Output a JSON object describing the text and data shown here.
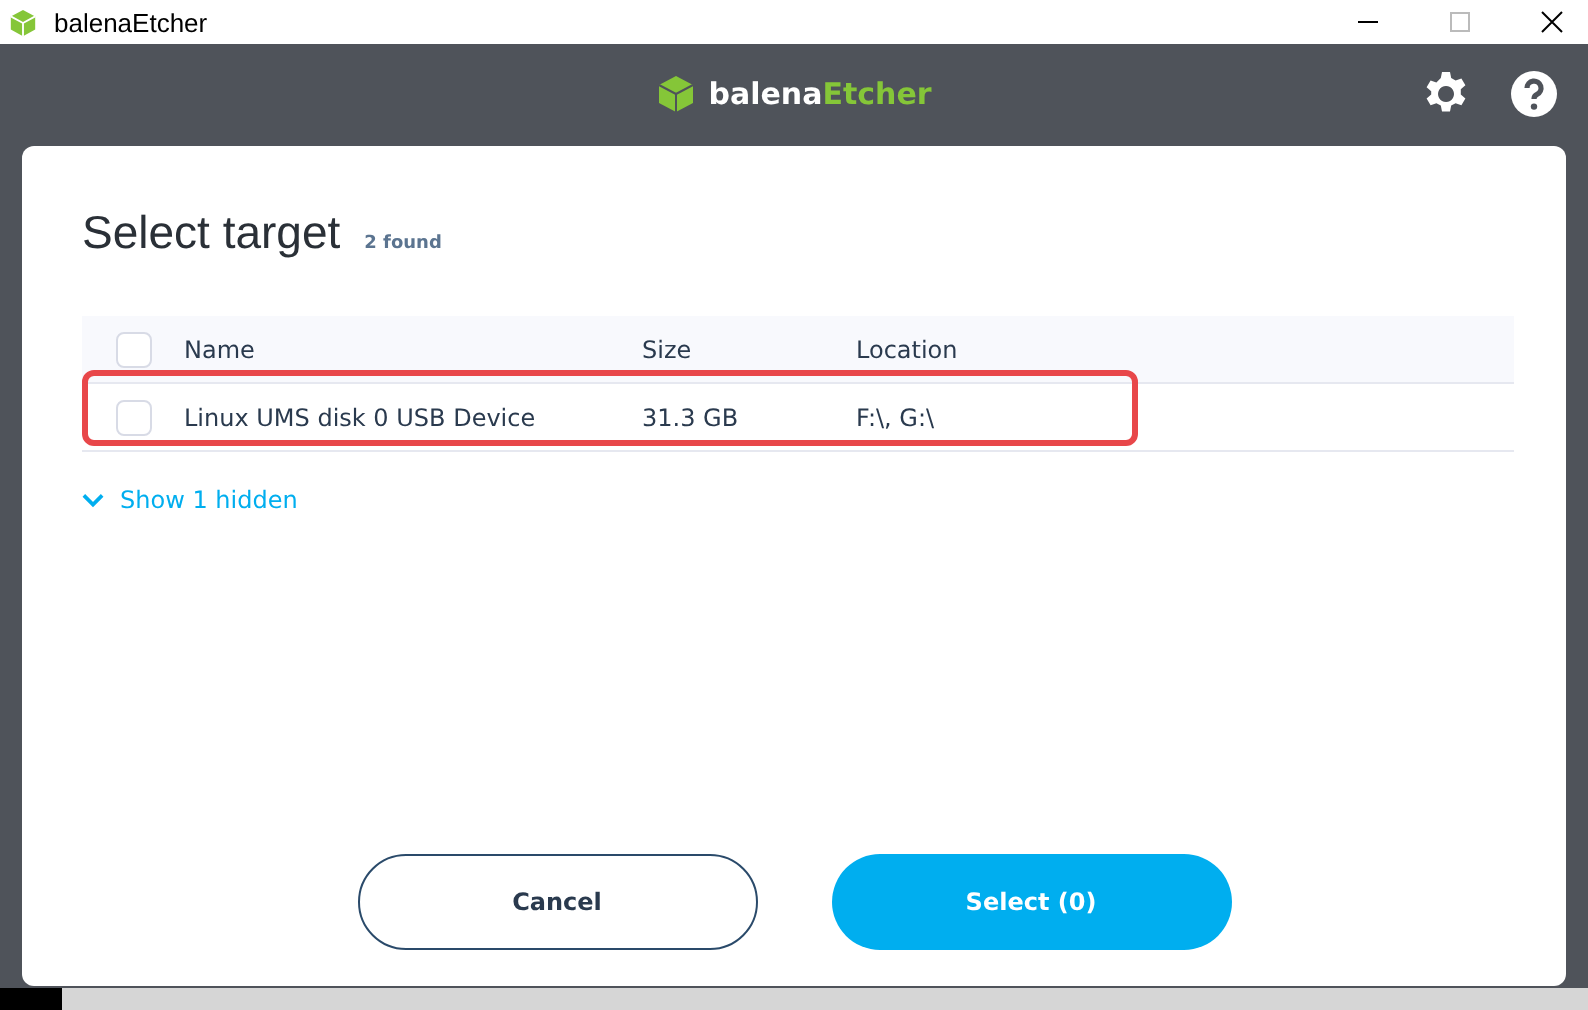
{
  "window": {
    "title": "balenaEtcher"
  },
  "header": {
    "logo_parts": [
      "balena",
      "Etcher"
    ]
  },
  "dialog": {
    "title": "Select target",
    "count": "2 found",
    "table": {
      "all_checked": false,
      "columns": [
        "Name",
        "Size",
        "Location"
      ],
      "rows": [
        {
          "cells": [
            "Linux UMS disk 0 USB Device",
            "31.3 GB",
            "F:\\, G:\\"
          ],
          "checked": false,
          "highlighted": true
        }
      ]
    },
    "show_hidden": "Show 1 hidden",
    "buttons": [
      {
        "label": "Cancel",
        "kind": "secondary"
      },
      {
        "label": "Select (0)",
        "kind": "primary"
      }
    ]
  }
}
